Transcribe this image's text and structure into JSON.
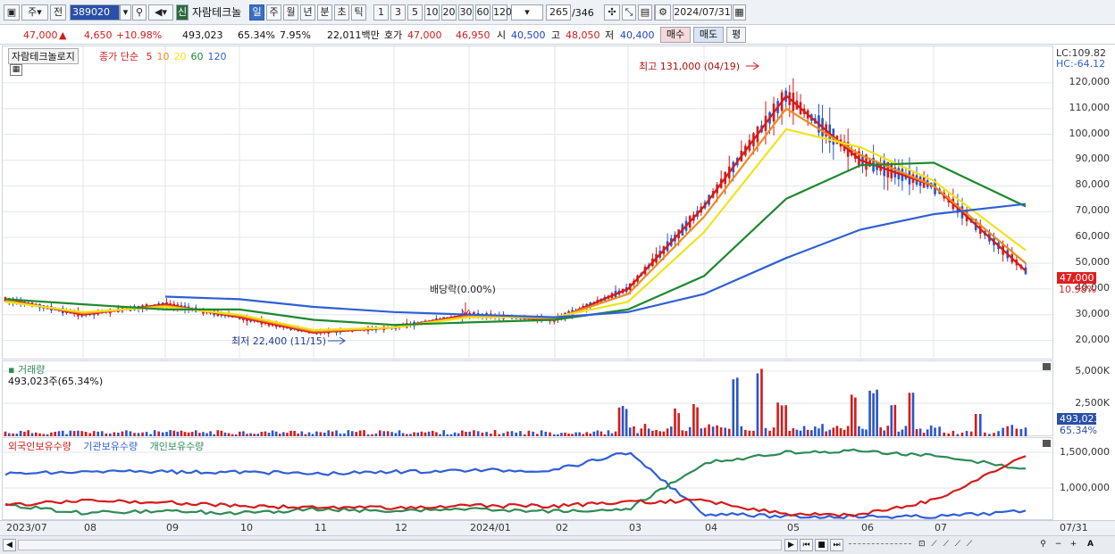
{
  "toolbar": {
    "type_label": "주",
    "prev_label": "전",
    "code_value": "389020",
    "cat_label": "신",
    "stock_name": "자람테크놀",
    "periods": [
      "일",
      "주",
      "월",
      "년",
      "분",
      "초",
      "틱"
    ],
    "active_period": "일",
    "intervals": [
      "1",
      "3",
      "5",
      "10",
      "20",
      "30",
      "60",
      "120"
    ],
    "count_value": "265",
    "count_total": "/346",
    "date_value": "2024/07/31"
  },
  "quote": {
    "price": "47,000",
    "arrow": "▲",
    "change": "4,650",
    "change_pct": "+10.98%",
    "volume": "493,023",
    "volume_ratio": "65.34%",
    "turnover": "7.95%",
    "amount": "22,011백만",
    "ask_label": "호가",
    "ask1": "47,000",
    "ask2": "46,950",
    "open_label": "시",
    "open": "40,500",
    "high_label": "고",
    "high": "48,050",
    "low_label": "저",
    "low": "40,400",
    "buy_label": "매수",
    "sell_label": "매도",
    "eval_label": "평"
  },
  "price_pane": {
    "name_tag": "자람테크놀로지",
    "ma_label": "종가 단순",
    "ma_periods": [
      "5",
      "10",
      "20",
      "60",
      "120"
    ],
    "ma_colors": [
      "#d61a1a",
      "#f08a1c",
      "#f2e21d",
      "#1e8a2e",
      "#2f5fd6"
    ],
    "lc": "LC:109.82",
    "hc": "HC:-64.12",
    "yticks": [
      "120,000",
      "110,000",
      "100,000",
      "90,000",
      "80,000",
      "70,000",
      "60,000",
      "50,000",
      "40,000",
      "30,000",
      "20,000"
    ],
    "cur_price_tag": "47,000",
    "cur_pct_tag": "10.98%",
    "high_annot": "최고 131,000 (04/19)",
    "low_annot": "최저 22,400 (11/15)",
    "div_annot": "배당락(0.00%)"
  },
  "volume_pane": {
    "title": "거래량",
    "readout": "493,023주(65.34%)",
    "yticks": [
      "5,000K",
      "2,500K"
    ],
    "cur_tag": "493,023",
    "cur_pct": "65.34%"
  },
  "holding_pane": {
    "legend": [
      "외국인보유수량",
      "기관보유수량",
      "개인보유수량"
    ],
    "colors": [
      "#d61a1a",
      "#2f5fd6",
      "#2e8b57"
    ],
    "yticks": [
      "1,500,000",
      "1,000,000"
    ]
  },
  "xaxis": {
    "labels": [
      "2023/07",
      "08",
      "09",
      "10",
      "11",
      "12",
      "2024/01",
      "02",
      "03",
      "04",
      "05",
      "06",
      "07"
    ],
    "end_label": "07/31"
  },
  "chart_data": {
    "type": "line",
    "title": "자람테크놀로지",
    "ylim": [
      15000,
      130000
    ],
    "x": [
      "2023/07",
      "08",
      "09",
      "10",
      "11",
      "12",
      "2024/01",
      "02",
      "03",
      "04",
      "05",
      "06",
      "07",
      "07/31"
    ],
    "series": [
      {
        "name": "5",
        "values": [
          36000,
          30000,
          34000,
          29000,
          23000,
          25000,
          30000,
          28000,
          40000,
          72000,
          115000,
          90000,
          80000,
          47000
        ]
      },
      {
        "name": "10",
        "values": [
          35500,
          30500,
          33500,
          29500,
          23500,
          25000,
          29500,
          28500,
          38000,
          68000,
          110000,
          92000,
          80000,
          50000
        ]
      },
      {
        "name": "20",
        "values": [
          35000,
          31000,
          33000,
          30000,
          24000,
          25000,
          29000,
          29000,
          35000,
          62000,
          102000,
          95000,
          82000,
          55000
        ]
      },
      {
        "name": "60",
        "values": [
          36000,
          34000,
          32000,
          32000,
          28000,
          26000,
          27000,
          28000,
          32000,
          45000,
          75000,
          88000,
          89000,
          72000
        ]
      },
      {
        "name": "120",
        "values": [
          null,
          null,
          37000,
          36000,
          33000,
          31000,
          30000,
          29000,
          31000,
          38000,
          52000,
          63000,
          69000,
          73000
        ]
      }
    ],
    "annotations": [
      "최고 131,000 (04/19)",
      "최저 22,400 (11/15)",
      "배당락(0.00%)"
    ]
  }
}
